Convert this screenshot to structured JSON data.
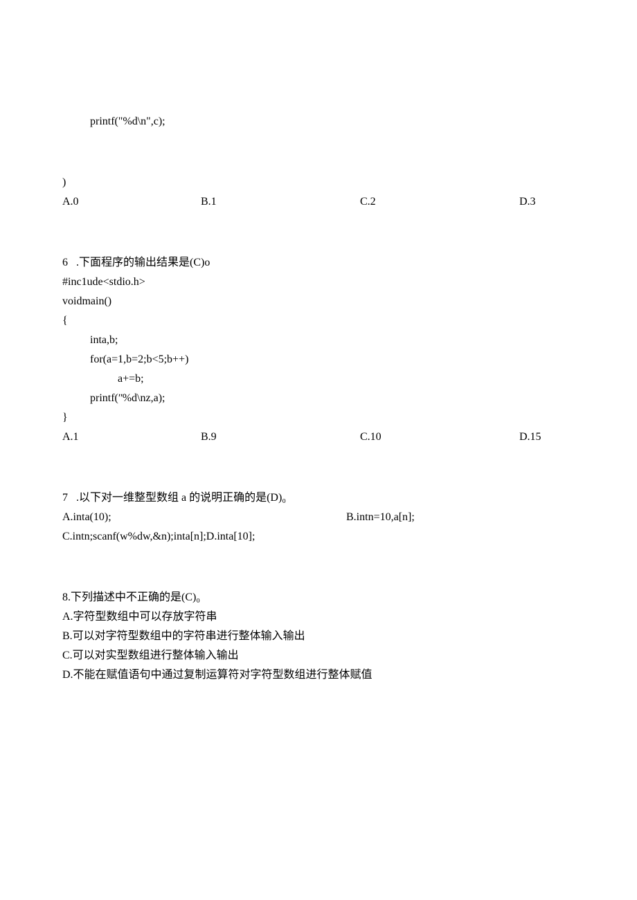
{
  "q5": {
    "code_line": "printf(\"%d\\n\",c);",
    "close": ")",
    "choices": {
      "a": "A.0",
      "b": "B.1",
      "c": "C.2",
      "d": "D.3"
    }
  },
  "q6": {
    "prompt": "6   .下面程序的输出结果是(C)o",
    "code": {
      "l1": "#inc1ude<stdio.h>",
      "l2": "voidmain()",
      "l3": "{",
      "l4": "inta,b;",
      "l5": "for(a=1,b=2;b<5;b++)",
      "l6": "a+=b;",
      "l7": "printf(ʺ%d\\nz,a);",
      "l8": "}"
    },
    "choices": {
      "a": "A.1",
      "b": "B.9",
      "c": "C.10",
      "d": "D.15"
    }
  },
  "q7": {
    "prompt": "7   .以下对一维整型数组 a 的说明正确的是(D)₀",
    "a": "A.inta(10);",
    "b": "B.intn=10,a[n];",
    "c": "C.intn;scanf(w%dw,&n);inta[n];D.inta[10];"
  },
  "q8": {
    "prompt": "8.下列描述中不正确的是(C)₀",
    "a": "A.字符型数组中可以存放字符串",
    "b": "B.可以对字符型数组中的字符串进行整体输入输出",
    "c": "C.可以对实型数组进行整体输入输出",
    "d": "D.不能在赋值语句中通过复制运算符对字符型数组进行整体赋值"
  }
}
